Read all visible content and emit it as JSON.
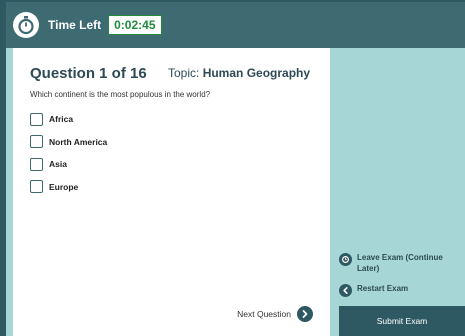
{
  "header": {
    "time_left_label": "Time Left",
    "time_remaining": "0:02:45",
    "timer_color": "#1e8a3c"
  },
  "question": {
    "title": "Question 1 of 16",
    "topic_label": "Topic: ",
    "topic": "Human Geography",
    "prompt": "Which continent is the most populous in the world?",
    "options": [
      {
        "label": "Africa",
        "checked": false
      },
      {
        "label": "North America",
        "checked": false
      },
      {
        "label": "Asia",
        "checked": false
      },
      {
        "label": "Europe",
        "checked": false
      }
    ],
    "next_label": "Next Question"
  },
  "side": {
    "leave_label": "Leave Exam (Continue Later)",
    "restart_label": "Restart Exam",
    "submit_label": "Submit Exam"
  },
  "colors": {
    "background": "#a6d6d5",
    "header": "#3e6a72",
    "accent": "#2e5963"
  }
}
